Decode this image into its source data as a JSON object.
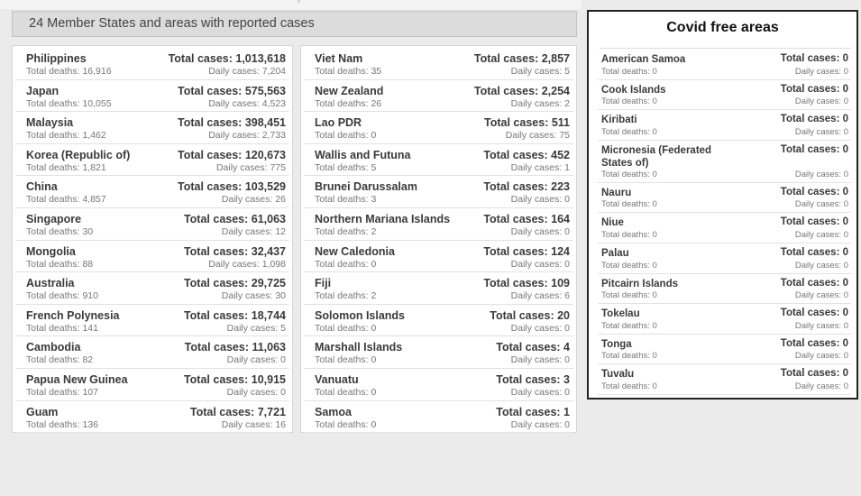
{
  "header": {
    "title": "24 Member States and areas with reported cases"
  },
  "reported": {
    "column1": [
      {
        "name": "Philippines",
        "total": "Total cases: 1,013,618",
        "deaths": "Total deaths: 16,916",
        "daily": "Daily cases: 7,204"
      },
      {
        "name": "Japan",
        "total": "Total cases: 575,563",
        "deaths": "Total deaths: 10,055",
        "daily": "Daily cases: 4,523"
      },
      {
        "name": "Malaysia",
        "total": "Total cases: 398,451",
        "deaths": "Total deaths: 1,462",
        "daily": "Daily cases: 2,733"
      },
      {
        "name": "Korea (Republic of)",
        "total": "Total cases: 120,673",
        "deaths": "Total deaths: 1,821",
        "daily": "Daily cases: 775"
      },
      {
        "name": "China",
        "total": "Total cases: 103,529",
        "deaths": "Total deaths: 4,857",
        "daily": "Daily cases: 26"
      },
      {
        "name": "Singapore",
        "total": "Total cases: 61,063",
        "deaths": "Total deaths: 30",
        "daily": "Daily cases: 12"
      },
      {
        "name": "Mongolia",
        "total": "Total cases: 32,437",
        "deaths": "Total deaths: 88",
        "daily": "Daily cases: 1,098"
      },
      {
        "name": "Australia",
        "total": "Total cases: 29,725",
        "deaths": "Total deaths: 910",
        "daily": "Daily cases: 30"
      },
      {
        "name": "French Polynesia",
        "total": "Total cases: 18,744",
        "deaths": "Total deaths: 141",
        "daily": "Daily cases: 5"
      },
      {
        "name": "Cambodia",
        "total": "Total cases: 11,063",
        "deaths": "Total deaths: 82",
        "daily": "Daily cases: 0"
      },
      {
        "name": "Papua New Guinea",
        "total": "Total cases: 10,915",
        "deaths": "Total deaths: 107",
        "daily": "Daily cases: 0"
      },
      {
        "name": "Guam",
        "total": "Total cases: 7,721",
        "deaths": "Total deaths: 136",
        "daily": "Daily cases: 16"
      }
    ],
    "column2": [
      {
        "name": "Viet Nam",
        "total": "Total cases: 2,857",
        "deaths": "Total deaths: 35",
        "daily": "Daily cases: 5"
      },
      {
        "name": "New Zealand",
        "total": "Total cases: 2,254",
        "deaths": "Total deaths: 26",
        "daily": "Daily cases: 2"
      },
      {
        "name": "Lao PDR",
        "total": "Total cases: 511",
        "deaths": "Total deaths: 0",
        "daily": "Daily cases: 75"
      },
      {
        "name": "Wallis and Futuna",
        "total": "Total cases: 452",
        "deaths": "Total deaths: 5",
        "daily": "Daily cases: 1"
      },
      {
        "name": "Brunei Darussalam",
        "total": "Total cases: 223",
        "deaths": "Total deaths: 3",
        "daily": "Daily cases: 0"
      },
      {
        "name": "Northern Mariana Islands",
        "total": "Total cases: 164",
        "deaths": "Total deaths: 2",
        "daily": "Daily cases: 0"
      },
      {
        "name": "New Caledonia",
        "total": "Total cases: 124",
        "deaths": "Total deaths: 0",
        "daily": "Daily cases: 0"
      },
      {
        "name": "Fiji",
        "total": "Total cases: 109",
        "deaths": "Total deaths: 2",
        "daily": "Daily cases: 6"
      },
      {
        "name": "Solomon Islands",
        "total": "Total cases: 20",
        "deaths": "Total deaths: 0",
        "daily": "Daily cases: 0"
      },
      {
        "name": "Marshall Islands",
        "total": "Total cases: 4",
        "deaths": "Total deaths: 0",
        "daily": "Daily cases: 0"
      },
      {
        "name": "Vanuatu",
        "total": "Total cases: 3",
        "deaths": "Total deaths: 0",
        "daily": "Daily cases: 0"
      },
      {
        "name": "Samoa",
        "total": "Total cases: 1",
        "deaths": "Total deaths: 0",
        "daily": "Daily cases: 0"
      }
    ]
  },
  "covid_free": {
    "title": "Covid free areas",
    "items": [
      {
        "name": "American Samoa",
        "total": "Total cases: 0",
        "deaths": "Total deaths: 0",
        "daily": "Daily cases: 0"
      },
      {
        "name": "Cook Islands",
        "total": "Total cases: 0",
        "deaths": "Total deaths: 0",
        "daily": "Daily cases: 0"
      },
      {
        "name": "Kiribati",
        "total": "Total cases: 0",
        "deaths": "Total deaths: 0",
        "daily": "Daily cases: 0"
      },
      {
        "name": "Micronesia (Federated States of)",
        "total": "Total cases: 0",
        "deaths": "Total deaths: 0",
        "daily": "Daily cases: 0"
      },
      {
        "name": "Nauru",
        "total": "Total cases: 0",
        "deaths": "Total deaths: 0",
        "daily": "Daily cases: 0"
      },
      {
        "name": "Niue",
        "total": "Total cases: 0",
        "deaths": "Total deaths: 0",
        "daily": "Daily cases: 0"
      },
      {
        "name": "Palau",
        "total": "Total cases: 0",
        "deaths": "Total deaths: 0",
        "daily": "Daily cases: 0"
      },
      {
        "name": "Pitcairn Islands",
        "total": "Total cases: 0",
        "deaths": "Total deaths: 0",
        "daily": "Daily cases: 0"
      },
      {
        "name": "Tokelau",
        "total": "Total cases: 0",
        "deaths": "Total deaths: 0",
        "daily": "Daily cases: 0"
      },
      {
        "name": "Tonga",
        "total": "Total cases: 0",
        "deaths": "Total deaths: 0",
        "daily": "Daily cases: 0"
      },
      {
        "name": "Tuvalu",
        "total": "Total cases: 0",
        "deaths": "Total deaths: 0",
        "daily": "Daily cases: 0"
      }
    ]
  }
}
